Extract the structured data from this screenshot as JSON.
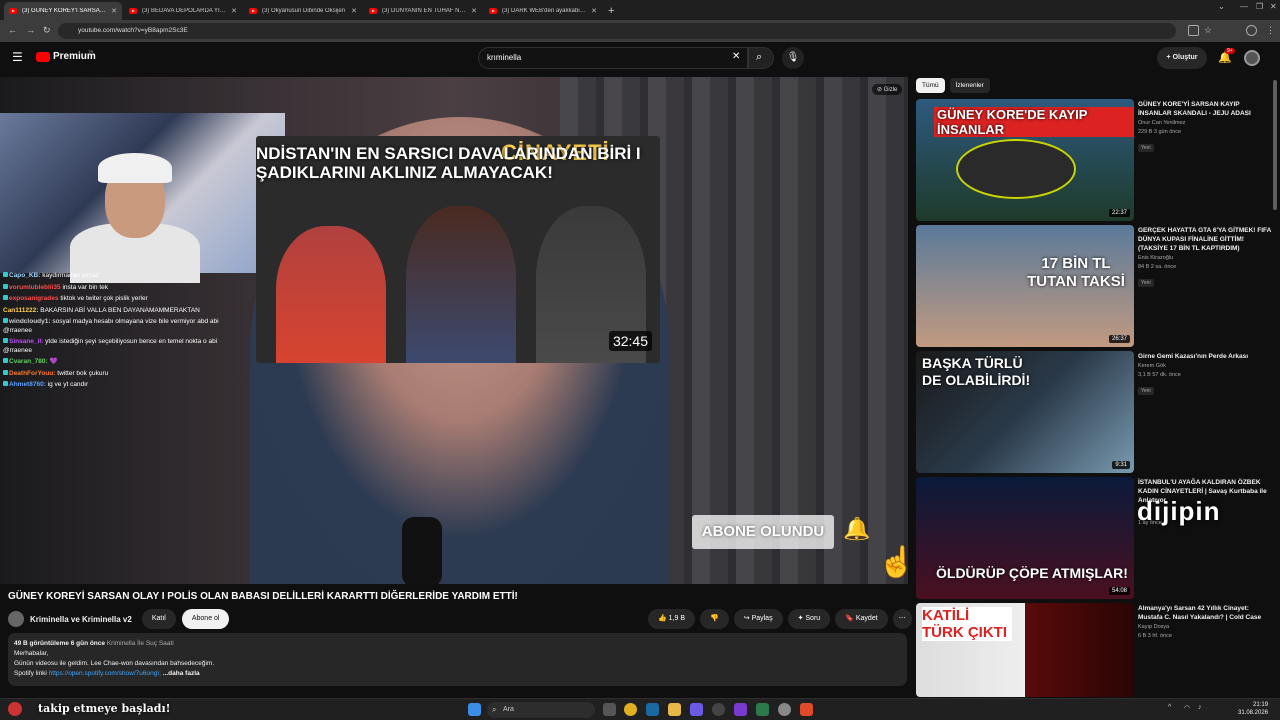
{
  "browser": {
    "tabs": [
      {
        "label": "(3) GÜNEY KOREY'İ SARSAN OL",
        "active": true
      },
      {
        "label": "(3) BEDAVA DEPOLARDA YILIN",
        "active": false
      },
      {
        "label": "(3) Okyanusun Dibinde Oksijen",
        "active": false
      },
      {
        "label": "(3) DÜNYANIN EN TUHAF NÜK",
        "active": false
      },
      {
        "label": "(3) DARK WEB'den ayakkabı SİP",
        "active": false
      }
    ],
    "url": "youtube.com/watch?v=yB8apm2Sc3E"
  },
  "header": {
    "logo": "Premium",
    "logo_sup": "TR",
    "search_value": "krıminella",
    "create_label": "Oluştur",
    "notif_count": "9+"
  },
  "video": {
    "webcam_chat": [
      {
        "user": "Capo_KB:",
        "text": "kaydırmadan olmaz",
        "color": "#9ad0ff"
      },
      {
        "user": "vorumlubleblii35",
        "text": "insta var bin tek",
        "color": "#ff4d4d"
      },
      {
        "user": "exposanigrades",
        "text": "tiktok ve twiter çok pislik yerler",
        "color": "#ff4d4d"
      },
      {
        "user": "Can111222:",
        "text": "BAKARSIN ABİ VALLA BEN DAYANAMAMMERAKTAN",
        "color": "#ffd24d"
      },
      {
        "user": "windcloudy1:",
        "text": "sosyal madya hesabı olmayana vize bile vermiyor abd abi @rraenee",
        "color": "#cfcfcf"
      },
      {
        "user": "Sinsane_il:",
        "text": "ytde istediğin şeyi seçebiliyosun bence en temel nokta o abi @rraenee",
        "color": "#c34dff"
      },
      {
        "user": "Cvaran_780:",
        "text": "",
        "color": "#5fd45f"
      },
      {
        "user": "DeathForYouu:",
        "text": "twitter bok çukuru",
        "color": "#ff7a2e"
      },
      {
        "user": "Ahmet8760:",
        "text": "ig ve yt candır",
        "color": "#5aa0ff"
      }
    ],
    "thumb_title": "NDİSTAN'IN EN SARSICI DAVALARINDAN BİRİ I ŞADIKLARINI AKLINIZ ALMAYACAK!",
    "thumb_title_right": "CİNAYETİ",
    "thumb_duration": "32:45",
    "abone_label": "ABONE OLUNDU",
    "gizle_label": "Gizle",
    "follow_toast": "takip etmeye başladı!",
    "watermark": "dijipin"
  },
  "main": {
    "title": "GÜNEY KOREYİ SARSAN OLAY I POLİS OLAN BABASI DELİLLERİ KARARTTI DİĞERLERİDE YARDIM ETTİ!",
    "channel_name": "Kriminella ve Kriminella v2",
    "join_label": "Katıl",
    "subscribe_label": "Abone ol",
    "like_count": "1,9 B",
    "share_label": "Paylaş",
    "ask_label": "Soru",
    "save_label": "Kaydet",
    "desc_stats": "49 B görüntüleme  6 gün önce",
    "desc_tags": "Kriminella İle Suç Saati",
    "desc_line1": "Merhabalar,",
    "desc_line2": "Günün videosu ile geldim. Lee Chae-won davasından bahsedeceğim.",
    "desc_spotify_label": "Spotify linki",
    "desc_spotify_link": "https://open.spotify.com/show/7u6ong\\;",
    "desc_more": "...daha fazla"
  },
  "sidebar": {
    "chips": [
      "Tümü",
      "İzlenenler"
    ],
    "recs": [
      {
        "title": "GÜNEY KORE'Yİ SARSAN KAYIP İNSANLAR SKANDALI - JEJU ADASI",
        "channel": "Onur Can Yenilmez",
        "meta": "229 B  3 gün önce",
        "badge": "Yeni",
        "duration": "22:37",
        "caption": "GÜNEY KORE'DE KAYIP İNSANLAR"
      },
      {
        "title": "GERÇEK HAYATTA GTA 6'YA GİTMEK! FIFA DÜNYA KUPASI FİNALİNE GİTTİM! (TAKSİYE 17 BİN TL KAPTIRDIM)",
        "channel": "Enis Kirazoğlu",
        "meta": "84 B  2 sa. önce",
        "badge": "Yeni",
        "duration": "26:37",
        "caption": "17 BİN TL TUTAN TAKSİ"
      },
      {
        "title": "Girne Gemi Kazası'nın Perde Arkası",
        "channel": "Kerem Gök",
        "meta": "3,1 B  57 dk. önce",
        "badge": "Yeni",
        "duration": "9:31",
        "caption": "BAŞKA TÜRLÜ DE OLABİLİRDİ!"
      },
      {
        "title": "İSTANBUL'U AYAĞA KALDIRAN ÖZBEK KADIN CİNAYETLERİ | Savaş Kurtbaba ile Anlatıyor",
        "channel": "",
        "meta": "1 ay önce",
        "badge": "",
        "duration": "54:08",
        "caption": "ÖLDÜRÜP ÇÖPE ATMIŞLAR!"
      },
      {
        "title": "Almanya'yı Sarsan 42 Yıllık Cinayet: Mustafa C. Nasıl Yakalandı? | Cold Case",
        "channel": "Kayıp Dosya",
        "meta": "6 B  3 hf. önce",
        "badge": "",
        "duration": "",
        "caption": "KATİLİ TÜRK ÇIKTI"
      }
    ]
  },
  "taskbar": {
    "search_label": "Ara",
    "time": "21:19",
    "date": "31.08.2026"
  }
}
